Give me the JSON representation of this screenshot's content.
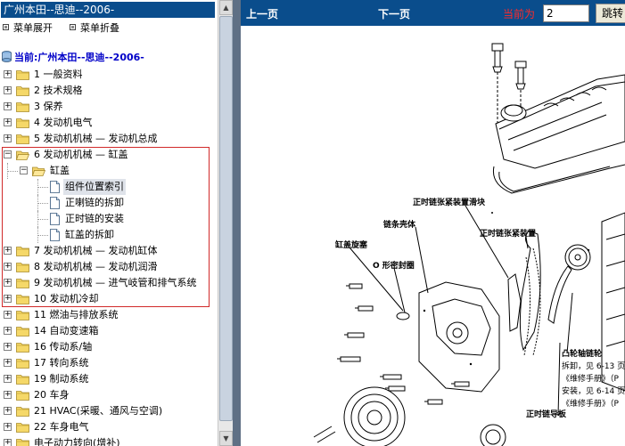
{
  "left_pane": {
    "title": "广州本田--思迪--2006-",
    "menu": {
      "expand_label": "菜单展开",
      "collapse_label": "菜单折叠"
    },
    "current_label": "当前:广州本田--思迪--2006-",
    "tree": [
      {
        "label": "1 一般资料",
        "expanded": false
      },
      {
        "label": "2 技术规格",
        "expanded": false
      },
      {
        "label": "3 保养",
        "expanded": false
      },
      {
        "label": "4 发动机电气",
        "expanded": false
      },
      {
        "label": "5 发动机机械 — 发动机总成",
        "expanded": false
      },
      {
        "label": "6 发动机机械 — 缸盖",
        "expanded": true
      },
      {
        "label": "缸盖",
        "expanded": true
      },
      {
        "label": "组件位置索引",
        "selected": true
      },
      {
        "label": "正喇链的拆卸"
      },
      {
        "label": "正时链的安装"
      },
      {
        "label": "缸盖的拆卸"
      },
      {
        "label": "7 发动机机械 — 发动机缸体",
        "expanded": false
      },
      {
        "label": "8 发动机机械 — 发动机润滑",
        "expanded": false
      },
      {
        "label": "9 发动机机械 — 进气岐管和排气系统",
        "expanded": false
      },
      {
        "label": "10 发动机冷却",
        "expanded": false
      },
      {
        "label": "11 燃油与排放系统",
        "expanded": false
      },
      {
        "label": "14 自动变速箱",
        "expanded": false
      },
      {
        "label": "16 传动系/轴",
        "expanded": false
      },
      {
        "label": "17 转向系统",
        "expanded": false
      },
      {
        "label": "19 制动系统",
        "expanded": false
      },
      {
        "label": "20 车身",
        "expanded": false
      },
      {
        "label": "21 HVAC(采暖、通风与空调)",
        "expanded": false
      },
      {
        "label": "22 车身电气",
        "expanded": false
      },
      {
        "label": "电子动力转向(增补)",
        "expanded": false
      }
    ]
  },
  "toolbar": {
    "prev_label": "上一页",
    "next_label": "下一页",
    "current_page_label": "当前为",
    "page_value": "2",
    "jump_label": "跳转"
  },
  "diagram": {
    "callouts": [
      "正时链张紧装置滑块",
      "链条壳体",
      "正时链张紧装置",
      "缸盖旋塞",
      "O 形密封圈",
      "凸轮轴链轮",
      "拆卸，见 6-13 页",
      "《维修手册》（P",
      "安装，见 6-14 页",
      "《维修手册》（P",
      "正时链导板"
    ]
  },
  "colors": {
    "title_bar": "#0a4d8c",
    "red_highlight": "#d12a2a",
    "header_blue": "#0000c8"
  }
}
